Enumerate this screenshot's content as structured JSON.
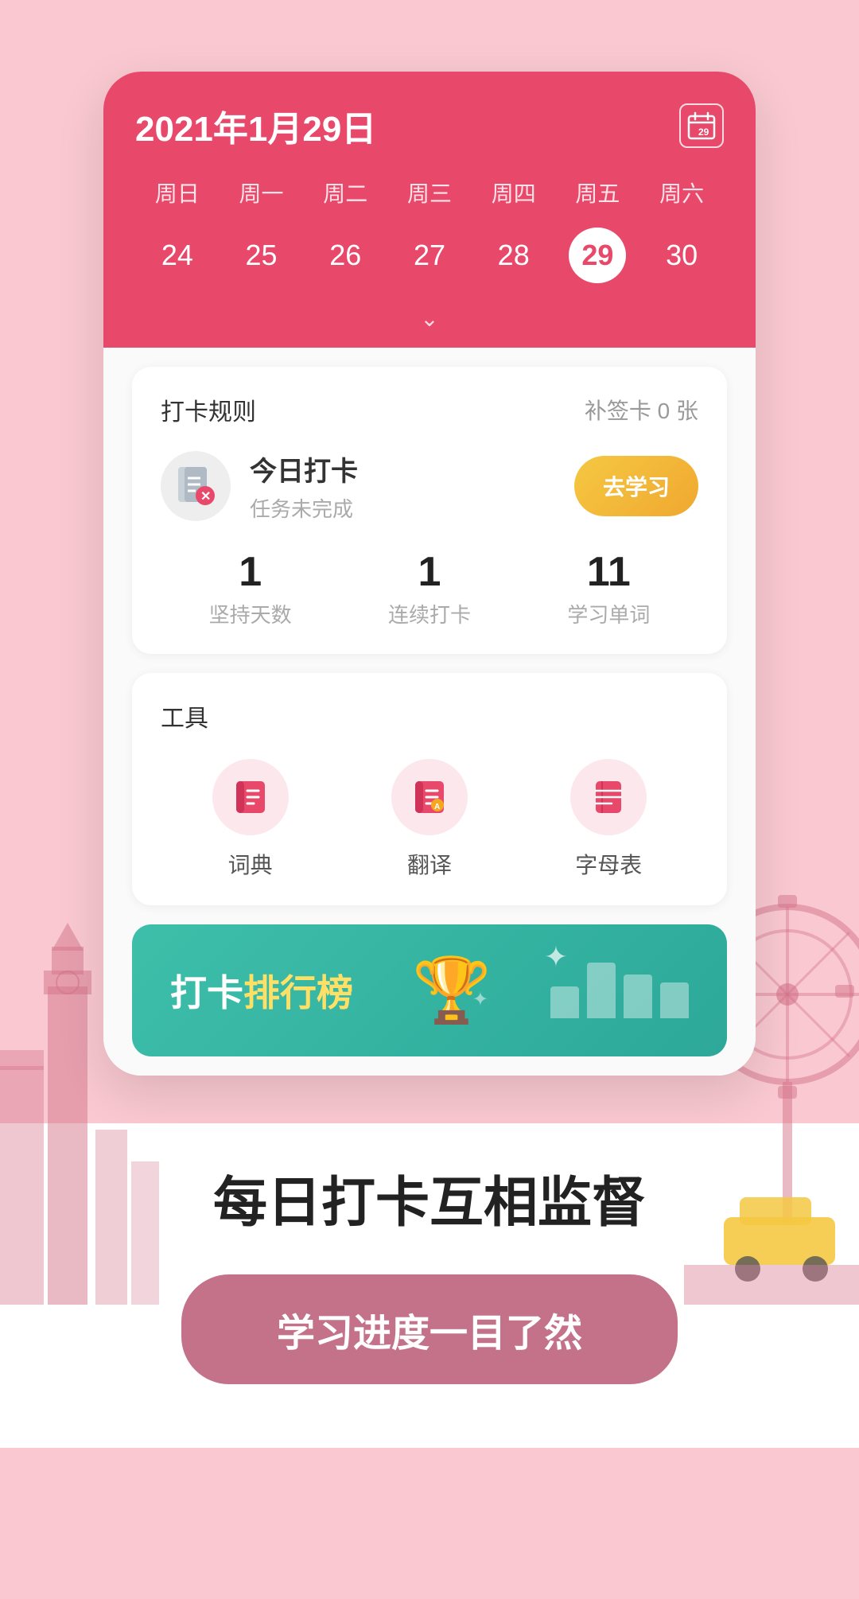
{
  "app": {
    "background_color": "#f9c8d0"
  },
  "calendar": {
    "title": "2021年1月29日",
    "icon_label": "29",
    "weekdays": [
      "周日",
      "周一",
      "周二",
      "周三",
      "周四",
      "周五",
      "周六"
    ],
    "dates": [
      "24",
      "25",
      "26",
      "27",
      "28",
      "29",
      "30"
    ],
    "active_date": "29"
  },
  "checkin_card": {
    "rules_label": "打卡规则",
    "supplement_label": "补签卡 0 张",
    "today_checkin_title": "今日打卡",
    "today_checkin_subtitle": "任务未完成",
    "go_study_label": "去学习",
    "stats": [
      {
        "value": "1",
        "label": "坚持天数"
      },
      {
        "value": "1",
        "label": "连续打卡"
      },
      {
        "value": "11",
        "label": "学习单词"
      }
    ]
  },
  "tools_card": {
    "title": "工具",
    "tools": [
      {
        "name": "词典",
        "icon": "book"
      },
      {
        "name": "翻译",
        "icon": "translate"
      },
      {
        "name": "字母表",
        "icon": "alphabet"
      }
    ]
  },
  "ranking_banner": {
    "text_prefix": "打卡",
    "text_highlight": "排行榜"
  },
  "bottom": {
    "tagline": "每日打卡互相监督",
    "cta_label": "学习进度一目了然"
  }
}
